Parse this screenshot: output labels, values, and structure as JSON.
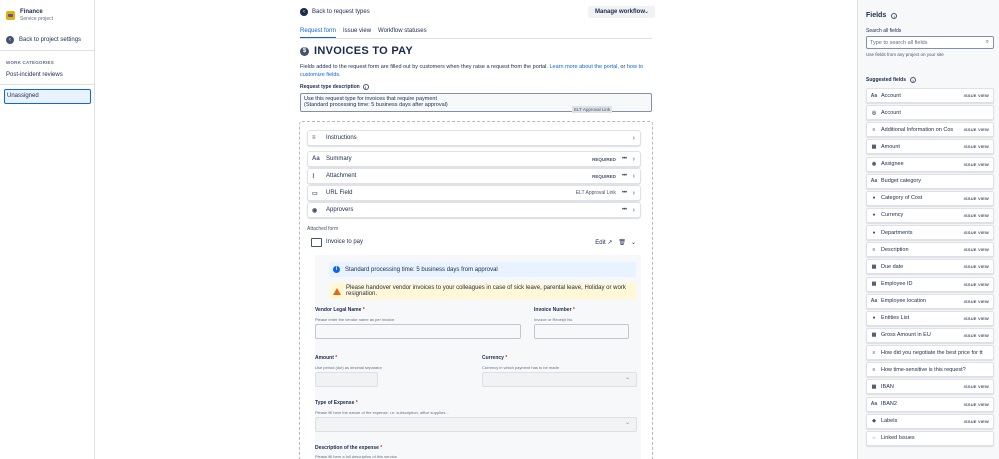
{
  "sidebar": {
    "project_name": "Finance",
    "project_type": "Service project",
    "back_label": "Back to project settings",
    "section_heading": "WORK CATEGORIES",
    "items": [
      {
        "label": "Post-incident reviews"
      },
      {
        "label": "Unassigned"
      }
    ]
  },
  "main": {
    "back_label": "Back to request types",
    "workflow_button": "Manage workflow",
    "tabs": [
      {
        "label": "Request form"
      },
      {
        "label": "Issue view"
      },
      {
        "label": "Workflow statuses"
      }
    ],
    "title": "INVOICES TO PAY",
    "fields_desc_1": "Fields added to the request form are filled out by customers when they raise a request from the portal. ",
    "fields_desc_link1": "Learn more about the portal",
    "fields_desc_mid": ", or ",
    "fields_desc_link2": "how to customize fields.",
    "request_type_label": "Request type description",
    "description_line1": "Use this request type for invoices that require payment",
    "description_line2": "(Standard processing time: 5 business days after approval)",
    "elt_tag": "ELT Approval Link",
    "form_rows": [
      {
        "icon": "≡",
        "label": "Instructions",
        "required": "",
        "value": ""
      },
      {
        "icon": "Aa",
        "label": "Summary",
        "required": "REQUIRED",
        "value": ""
      },
      {
        "icon": "⌕",
        "label": "Attachment",
        "required": "REQUIRED",
        "value": ""
      },
      {
        "icon": "▭",
        "label": "URL Field",
        "required": "",
        "value": "ELT Approval Link"
      },
      {
        "icon": "◉",
        "label": "Approvers",
        "required": "",
        "value": ""
      }
    ],
    "attached_form_label": "Attached form",
    "attached_form_name": "Invoice to pay",
    "edit_label": "Edit",
    "preview": {
      "info_banner": "Standard processing time: 5 business days from approval",
      "warn_banner": "Please handover vendor invoices to your colleagues in case of sick leave, parental leave, Holiday or work resignation.",
      "vendor_label": "Vendor Legal Name",
      "vendor_help": "Please enter the vendor name as per invoice",
      "invoice_num_label": "Invoice Number",
      "invoice_num_help": "Invoice or Receipt No.",
      "amount_label": "Amount",
      "amount_help": "Use period (dot) as decimal separator",
      "currency_label": "Currency",
      "currency_help": "Currency in which payment has to be made",
      "expense_type_label": "Type of Expense",
      "expense_type_help": "Please fill here the nature of the expense. i.e: subscription, office supplies...",
      "expense_desc_label": "Description of the expense",
      "expense_desc_help": "Please fill here a full description of this service",
      "asterisk": "*"
    }
  },
  "right_panel": {
    "title": "Fields",
    "search_label": "Search all fields",
    "search_placeholder": "Type to search all fields",
    "note": "Use fields from any project on your site",
    "suggested_label": "Suggested fields",
    "issue_view": "ISSUE VIEW",
    "fields": [
      {
        "icon": "Aa",
        "name": "Account",
        "issue_view": true
      },
      {
        "icon": "◎",
        "name": "Account",
        "issue_view": false
      },
      {
        "icon": "≡",
        "name": "Additional Information on Cos",
        "issue_view": true
      },
      {
        "icon": "▦",
        "name": "Amount",
        "issue_view": true
      },
      {
        "icon": "◉",
        "name": "Assignee",
        "issue_view": true
      },
      {
        "icon": "Aa",
        "name": "Budget category",
        "issue_view": false
      },
      {
        "icon": "●",
        "name": "Category of Cost",
        "issue_view": true
      },
      {
        "icon": "●",
        "name": "Currency",
        "issue_view": true
      },
      {
        "icon": "●",
        "name": "Departments",
        "issue_view": true
      },
      {
        "icon": "≡",
        "name": "Description",
        "issue_view": true
      },
      {
        "icon": "▦",
        "name": "Due date",
        "issue_view": true
      },
      {
        "icon": "▦",
        "name": "Employee ID",
        "issue_view": true
      },
      {
        "icon": "Aa",
        "name": "Employee location",
        "issue_view": true
      },
      {
        "icon": "●",
        "name": "Entities List",
        "issue_view": true
      },
      {
        "icon": "▦",
        "name": "Gross Amount in EU",
        "issue_view": true
      },
      {
        "icon": "≡",
        "name": "How did you negotiate the best price for tt",
        "issue_view": false
      },
      {
        "icon": "≡",
        "name": "How time-sensitive is this request?",
        "issue_view": false
      },
      {
        "icon": "▦",
        "name": "IBAN",
        "issue_view": true
      },
      {
        "icon": "Aa",
        "name": "IBAN2",
        "issue_view": true
      },
      {
        "icon": "◆",
        "name": "Labels",
        "issue_view": true
      },
      {
        "icon": "⇔",
        "name": "Linked Issues",
        "issue_view": false
      }
    ]
  }
}
